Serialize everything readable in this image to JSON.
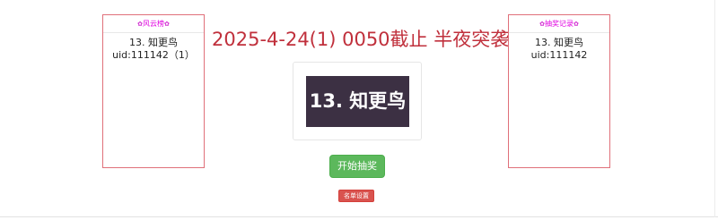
{
  "left_panel": {
    "title": "风云榜",
    "title_deco_left": "✿",
    "title_deco_right": "✿",
    "entries": [
      "13. 知更鸟 uid:111142（1）"
    ]
  },
  "right_panel": {
    "title": "抽奖记录",
    "title_deco_left": "✿",
    "title_deco_right": "✿",
    "entries": [
      "13. 知更鸟 uid:111142"
    ]
  },
  "main": {
    "title": "2025-4-24(1) 0050截止 半夜突袭",
    "winner_display": "13. 知更鸟"
  },
  "buttons": {
    "start_label": "开始抽奖",
    "list_settings_label": "名单设置"
  },
  "colors": {
    "title": "#c0303c",
    "panel_border": "#e0707a",
    "panel_title": "#e000e0",
    "winner_bg": "#3c3043",
    "start_button": "#5cb85c",
    "list_button": "#d9534f"
  }
}
